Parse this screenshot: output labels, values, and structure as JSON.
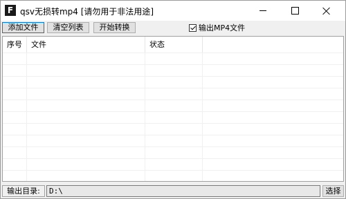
{
  "window": {
    "title": "qsv无损转mp4 [请勿用于非法用途]",
    "app_icon_letter": "F"
  },
  "toolbar": {
    "add_label": "添加文件",
    "clear_label": "清空列表",
    "start_label": "开始转换",
    "output_mp4_label": "输出MP4文件",
    "output_mp4_checked": true
  },
  "list": {
    "columns": [
      "序号",
      "文件",
      "状态"
    ],
    "rows": []
  },
  "footer": {
    "output_dir_label": "输出目录:",
    "output_dir_value": "D:\\",
    "choose_label": "选择"
  }
}
